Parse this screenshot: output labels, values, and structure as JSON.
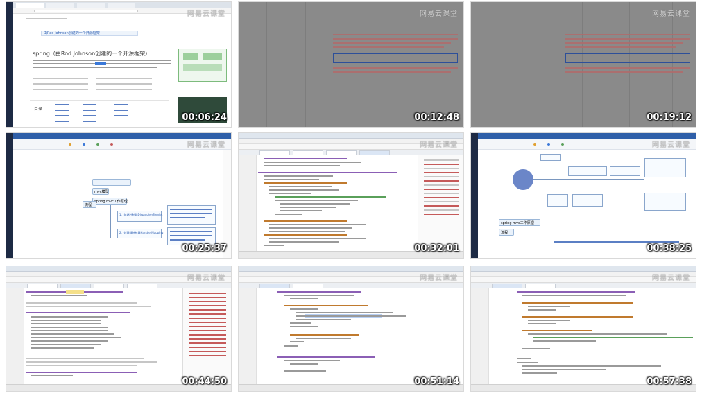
{
  "watermark": "网易云课堂",
  "thumbnails": [
    {
      "timestamp": "00:06:24",
      "kind": "browser"
    },
    {
      "timestamp": "00:12:48",
      "kind": "dim"
    },
    {
      "timestamp": "00:19:12",
      "kind": "dim"
    },
    {
      "timestamp": "00:25:37",
      "kind": "mindmap"
    },
    {
      "timestamp": "00:32:01",
      "kind": "ide"
    },
    {
      "timestamp": "00:38:25",
      "kind": "diagram"
    },
    {
      "timestamp": "00:44:50",
      "kind": "ide"
    },
    {
      "timestamp": "00:51:14",
      "kind": "ide"
    },
    {
      "timestamp": "00:57:38",
      "kind": "ide"
    }
  ],
  "browser": {
    "page_heading": "spring（由Rod Johnson创建的一个开源框架）",
    "banner": "由Rod Johnson创建的一个开源框架",
    "contents_label": "目录"
  },
  "mindmap": {
    "nodes": [
      "mvc模型",
      "spring mvc工作原理",
      "流程"
    ],
    "steps": [
      "1、前端控制器DispatcherServlet",
      "2、处理器映射器HandlerMapping"
    ]
  },
  "diagram": {
    "caption": "spring mvc工作原理",
    "label": "流程"
  },
  "colors": {
    "dim_bg": "#8a8a8a",
    "ide_bg": "#ffffff",
    "accent_blue": "#2d5fb3"
  }
}
